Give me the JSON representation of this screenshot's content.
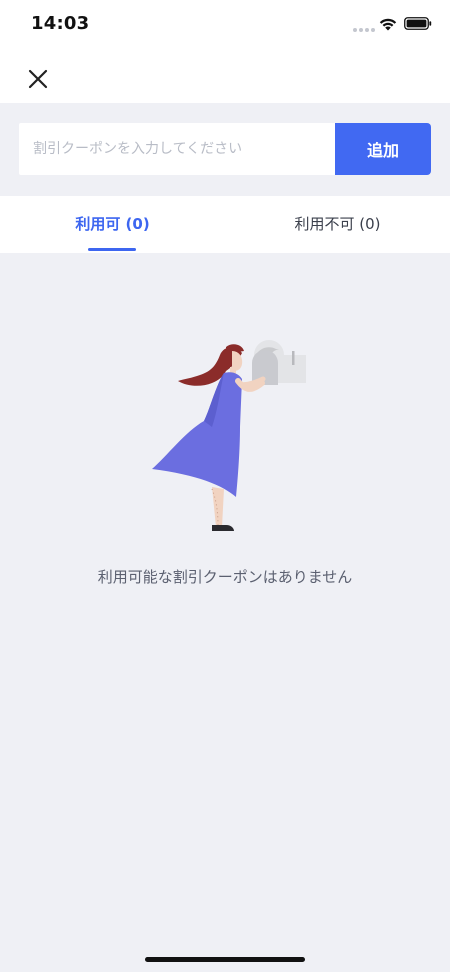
{
  "status_bar": {
    "time": "14:03"
  },
  "coupon": {
    "placeholder": "割引クーポンを入力してください",
    "value": "",
    "add_label": "追加"
  },
  "tabs": [
    {
      "label": "利用可 (0)",
      "active": true
    },
    {
      "label": "利用不可 (0)",
      "active": false
    }
  ],
  "empty_state": {
    "message": "利用可能な割引クーポンはありません"
  },
  "colors": {
    "accent": "#4169f2",
    "background": "#eff0f5",
    "dress": "#6b6ee0",
    "hair": "#8a2a2a"
  },
  "icons": {
    "close": "close-icon",
    "wifi": "wifi-icon",
    "battery": "battery-icon",
    "signal": "signal-icon"
  }
}
